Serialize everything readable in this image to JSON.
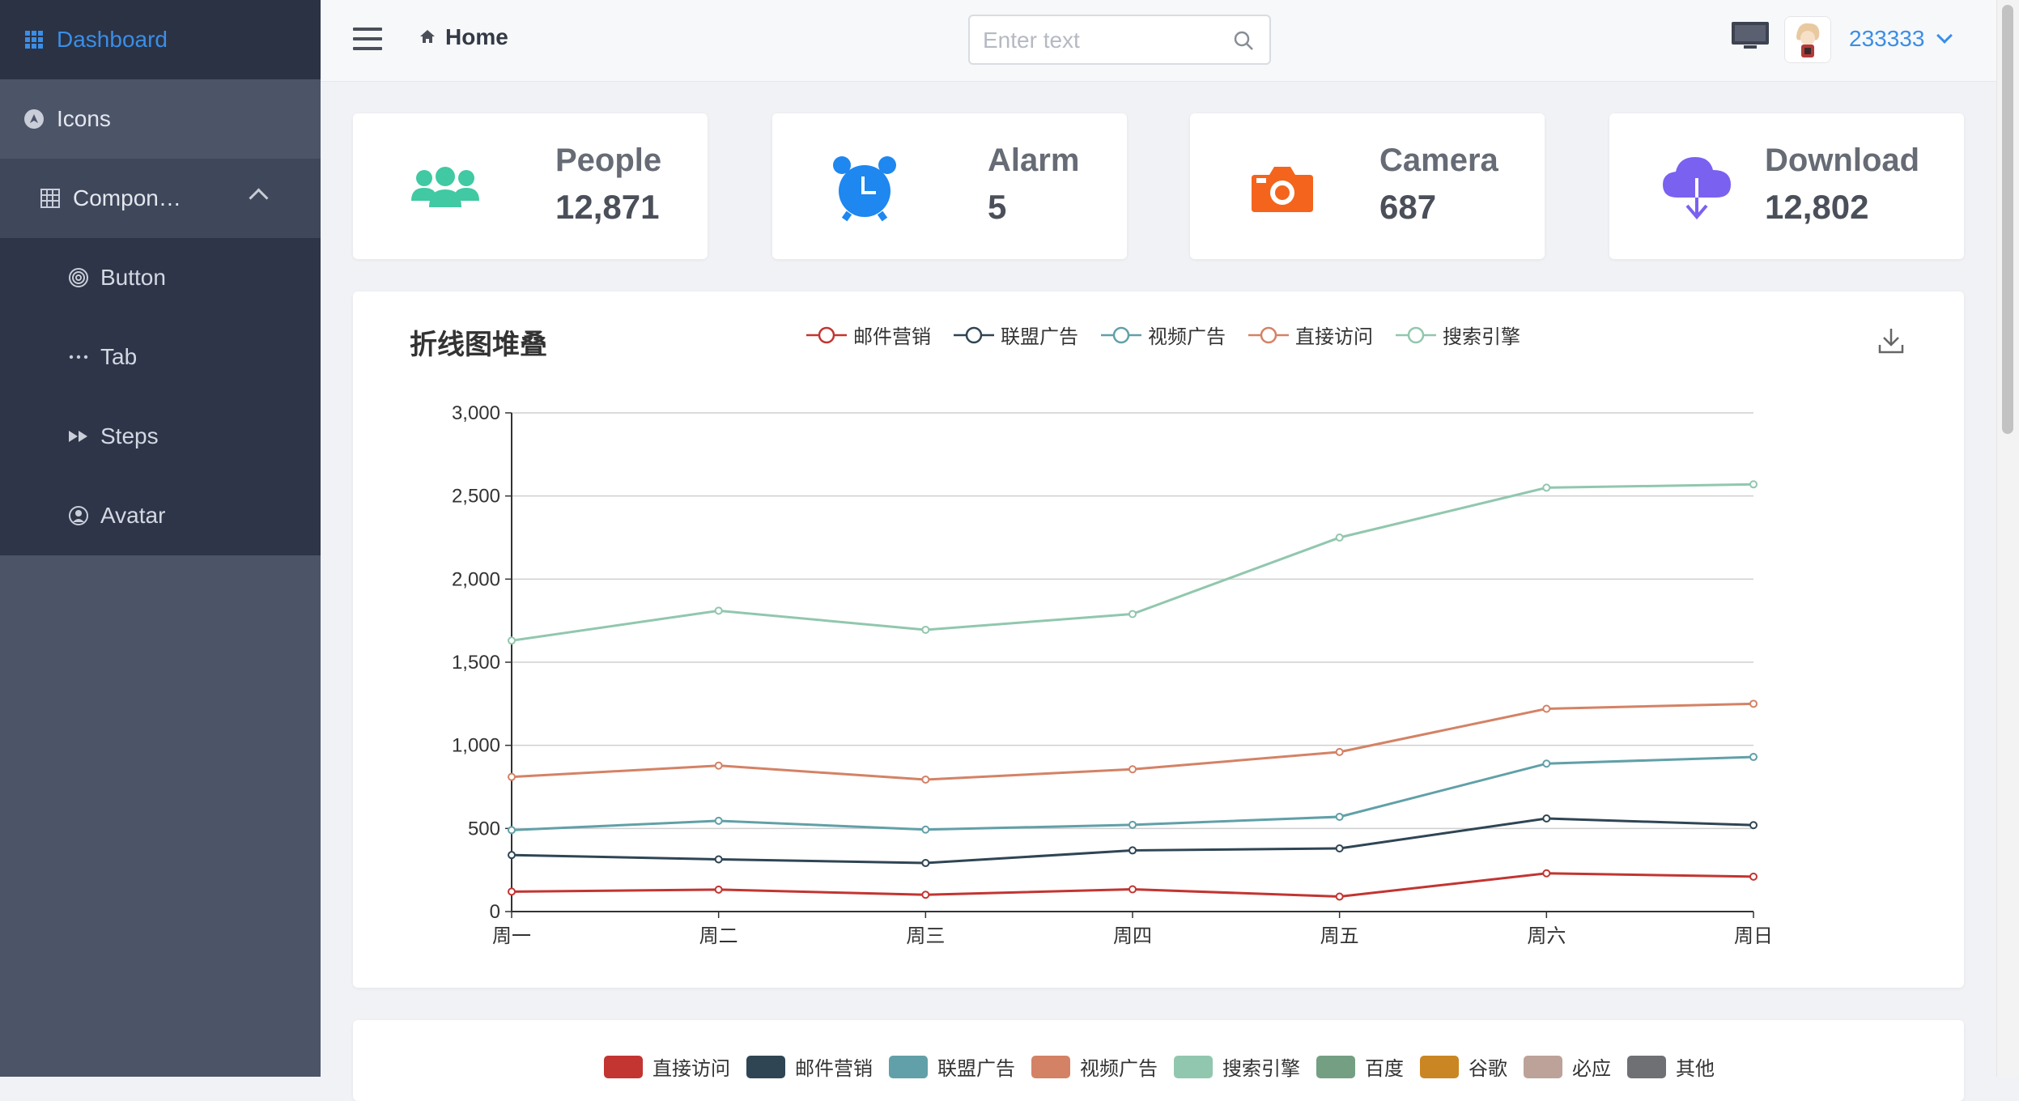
{
  "sidebar": {
    "active_label": "Dashboard",
    "icons_label": "Icons",
    "components_label": "Compon…",
    "sub_items": [
      {
        "label": "Button",
        "icon": "fingerprint-icon"
      },
      {
        "label": "Tab",
        "icon": "ellipsis-icon"
      },
      {
        "label": "Steps",
        "icon": "fast-forward-icon"
      },
      {
        "label": "Avatar",
        "icon": "user-circle-icon"
      }
    ]
  },
  "header": {
    "breadcrumb": "Home",
    "search_placeholder": "Enter text",
    "username": "233333"
  },
  "stats": [
    {
      "title": "People",
      "value": "12,871",
      "color": "#40c9a2",
      "icon": "people-icon"
    },
    {
      "title": "Alarm",
      "value": "5",
      "color": "#1e87f0",
      "icon": "alarm-clock-icon"
    },
    {
      "title": "Camera",
      "value": "687",
      "color": "#f4641d",
      "icon": "camera-icon"
    },
    {
      "title": "Download",
      "value": "12,802",
      "color": "#7b61f0",
      "icon": "cloud-download-icon"
    }
  ],
  "chart_data": {
    "type": "line",
    "title": "折线图堆叠",
    "categories": [
      "周一",
      "周二",
      "周三",
      "周四",
      "周五",
      "周六",
      "周日"
    ],
    "ylim": [
      0,
      3000
    ],
    "yticks": [
      "0",
      "500",
      "1,000",
      "1,500",
      "2,000",
      "2,500",
      "3,000"
    ],
    "stacked": true,
    "grid": true,
    "legend_position": "top",
    "series": [
      {
        "name": "邮件营销",
        "color": "#c23531",
        "values": [
          120,
          132,
          101,
          134,
          90,
          230,
          210
        ]
      },
      {
        "name": "联盟广告",
        "color": "#2f4554",
        "values": [
          220,
          182,
          191,
          234,
          290,
          330,
          310
        ]
      },
      {
        "name": "视频广告",
        "color": "#61a0a8",
        "values": [
          150,
          232,
          201,
          154,
          190,
          330,
          410
        ]
      },
      {
        "name": "直接访问",
        "color": "#d48265",
        "values": [
          320,
          332,
          301,
          334,
          390,
          330,
          320
        ]
      },
      {
        "name": "搜索引擎",
        "color": "#91c7ae",
        "values": [
          820,
          932,
          901,
          934,
          1290,
          1330,
          1320
        ]
      }
    ]
  },
  "bottom_legend": [
    {
      "label": "直接访问",
      "color": "#c23531"
    },
    {
      "label": "邮件营销",
      "color": "#2f4554"
    },
    {
      "label": "联盟广告",
      "color": "#61a0a8"
    },
    {
      "label": "视频广告",
      "color": "#d48265"
    },
    {
      "label": "搜索引擎",
      "color": "#91c7ae"
    },
    {
      "label": "百度",
      "color": "#749f83"
    },
    {
      "label": "谷歌",
      "color": "#ca8622"
    },
    {
      "label": "必应",
      "color": "#bda29a"
    },
    {
      "label": "其他",
      "color": "#6e7074"
    }
  ]
}
